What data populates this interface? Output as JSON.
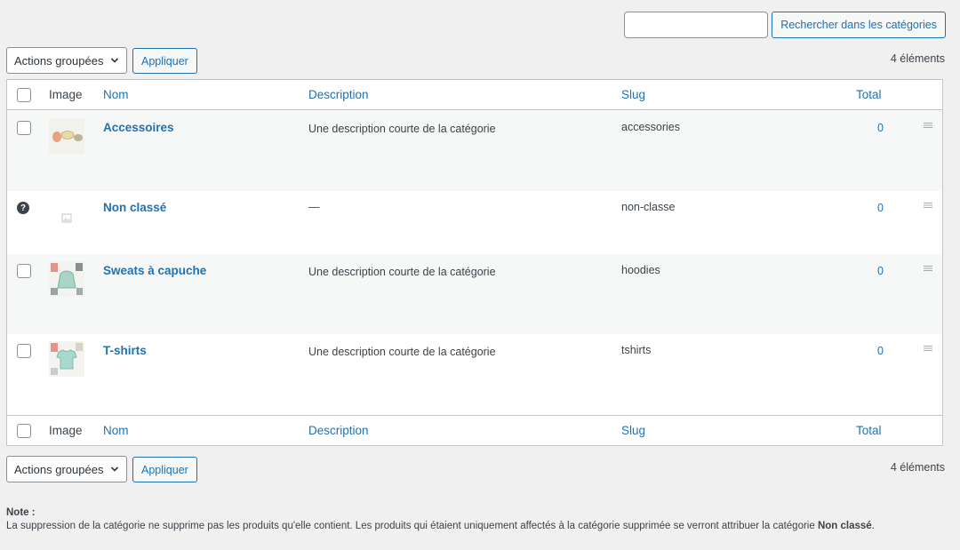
{
  "search": {
    "input_value": "",
    "input_placeholder": "",
    "button_label": "Rechercher dans les catégories"
  },
  "tablenav_top": {
    "bulk_action_label": "Actions groupées",
    "apply_label": "Appliquer",
    "count": "4 éléments"
  },
  "tablenav_bottom": {
    "bulk_action_label": "Actions groupées",
    "apply_label": "Appliquer",
    "count": "4 éléments"
  },
  "columns": {
    "image": "Image",
    "name": "Nom",
    "description": "Description",
    "slug": "Slug",
    "total": "Total"
  },
  "rows": [
    {
      "name": "Accessoires",
      "description": "Une description courte de la catégorie",
      "slug": "accessories",
      "total": "0",
      "selectable": true,
      "thumb": "accessories-thumbnail"
    },
    {
      "name": "Non classé",
      "description": "—",
      "slug": "non-classe",
      "total": "0",
      "selectable": false,
      "thumb": "placeholder-image"
    },
    {
      "name": "Sweats à capuche",
      "description": "Une description courte de la catégorie",
      "slug": "hoodies",
      "total": "0",
      "selectable": true,
      "thumb": "hoodie-thumbnail"
    },
    {
      "name": "T-shirts",
      "description": "Une description courte de la catégorie",
      "slug": "tshirts",
      "total": "0",
      "selectable": true,
      "thumb": "tshirt-thumbnail"
    }
  ],
  "note": {
    "title": "Note :",
    "body_before": "La suppression de la catégorie ne supprime pas les produits qu'elle contient. Les produits qui étaient uniquement affectés à la catégorie supprimée se verront attribuer la catégorie ",
    "body_bold": "Non classé",
    "body_after": "."
  },
  "colors": {
    "link": "#2271b1",
    "background": "#f0f0f1",
    "border": "#c3c4c7",
    "alt_row": "#f6f7f7"
  }
}
